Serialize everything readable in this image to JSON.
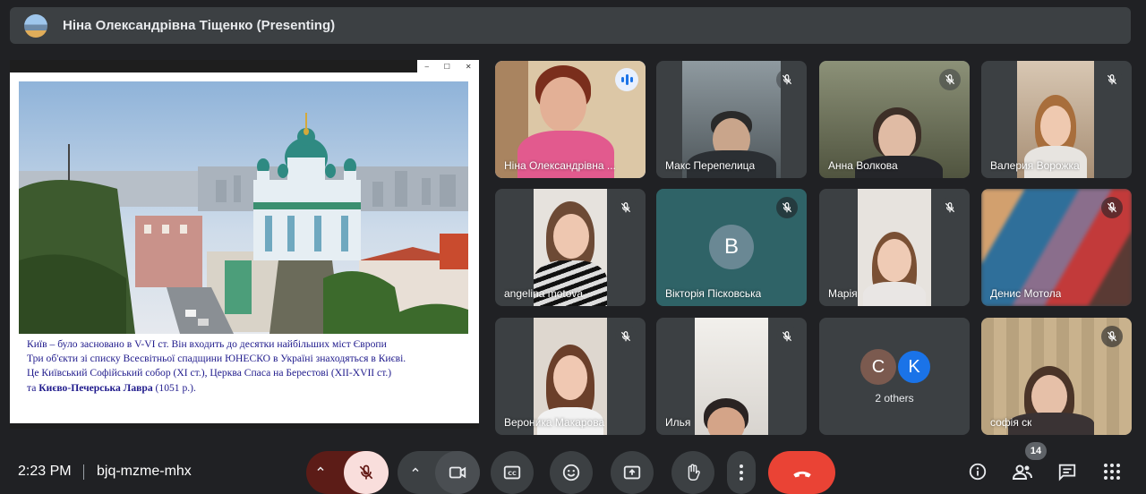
{
  "presenter_bar": {
    "title": "Ніна Олександрівна Тіщенко (Presenting)"
  },
  "slide": {
    "window_controls": [
      "–",
      "☐",
      "✕"
    ],
    "text_lines": [
      "Київ – було засновано  в V-VI ст. Він  входить до десятки найбільших міст Європи",
      "Три об'єкти зі списку Всесвітньої спадщини ЮНЕСКО в Україні знаходяться в Києві.",
      "Це Київський Софійський собор (XI ст.), Церква Спаса на Берестові (XII-XVII ст.)"
    ],
    "last_line_prefix": "та ",
    "last_line_bold": "Києво-Печерська Лавра",
    "last_line_suffix": " (1051 р.)."
  },
  "participants": [
    {
      "name": "Ніна Олександрівна ...",
      "speaking": true
    },
    {
      "name": "Макс Перепелица",
      "muted": true
    },
    {
      "name": "Анна Волкова",
      "muted": true
    },
    {
      "name": "Валерия Ворожка",
      "muted": true
    },
    {
      "name": "angelina motova",
      "muted": true
    },
    {
      "name": "Вікторія Пісковська",
      "muted": true,
      "initial": "В"
    },
    {
      "name": "Марія",
      "muted": true
    },
    {
      "name": "Денис Мотола",
      "muted": true
    },
    {
      "name": "Вероника Макарова",
      "muted": true
    },
    {
      "name": "Илья",
      "muted": true
    },
    {
      "name": "софія ск",
      "muted": true
    }
  ],
  "others_tile": {
    "initials": [
      "C",
      "K"
    ],
    "colors": [
      "#7b5a4f",
      "#1a73e8"
    ],
    "label": "2 others"
  },
  "bottom_bar": {
    "time": "2:23 PM",
    "meeting_code": "bjq-mzme-mhx",
    "participant_count": "14",
    "controls": [
      "mic-options",
      "mic-toggle",
      "camera-options",
      "camera-toggle",
      "captions",
      "reactions",
      "present",
      "raise-hand",
      "more-options",
      "leave-call"
    ],
    "right_icons": [
      "info-icon",
      "people-icon",
      "chat-icon",
      "activities-icon"
    ],
    "leave_color": "#ea4335",
    "mic_off_color": "#f9dedc"
  }
}
